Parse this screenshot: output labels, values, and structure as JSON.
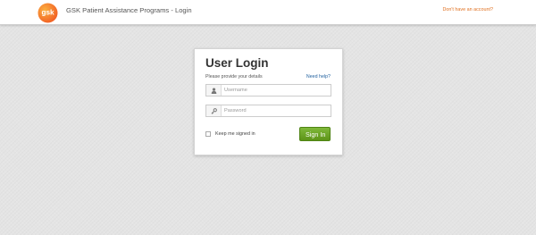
{
  "header": {
    "logo_text": "gsk",
    "title": "GSK Patient Assistance Programs - Login",
    "no_account_link": "Don't have an account?"
  },
  "login": {
    "title": "User Login",
    "subtitle": "Please provide your details",
    "need_help": "Need help?",
    "username": {
      "icon": "user-icon",
      "placeholder": "Username",
      "value": ""
    },
    "password": {
      "icon": "key-icon",
      "placeholder": "Password",
      "value": ""
    },
    "keep_signed_in": {
      "label": "Keep me signed in",
      "checked": false
    },
    "sign_in_label": "Sign In"
  },
  "colors": {
    "brand_orange": "#f36633",
    "link_orange": "#e07020",
    "button_green": "#6aa428",
    "help_blue": "#1f5f9e",
    "background": "#e4e4e4"
  }
}
